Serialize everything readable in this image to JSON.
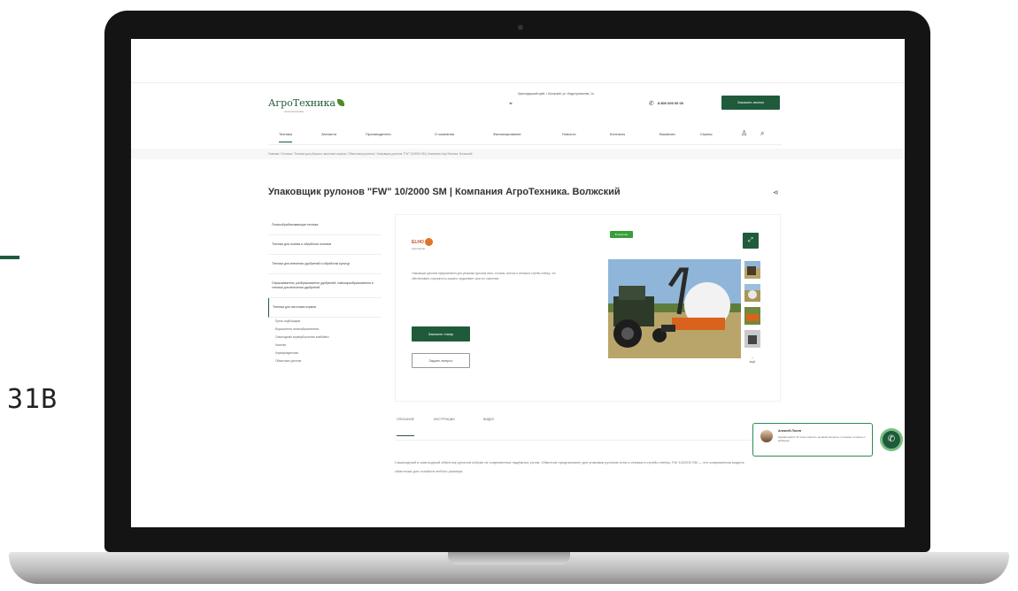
{
  "side_label": "31В",
  "header": {
    "logo_text": "АгроТехника",
    "logo_sub": "сельхозтехника",
    "address": "Краснодарский край, г. Волжский, ул. Индустриальная, 1а",
    "phone": "8 800 000 00 00",
    "callback_label": "Заказать звонок"
  },
  "nav": {
    "items": [
      "Техника",
      "Запчасти",
      "Производители",
      "О компании",
      "Финансирование",
      "Новости",
      "Контакты",
      "Вакансии",
      "Сервис"
    ],
    "active": "Техника"
  },
  "breadcrumb": "Главная  /  Техника  /  Техника для уборки и заготовки кормов  /  Обмотчики рулонов  /  Упаковщик рулонов \"FW\" 10/2000 SM | Компания АгроТехника. Волжский",
  "page_title": "Упаковщик рулонов \"FW\" 10/2000 SM | Компания АгроТехника. Волжский",
  "sidebar": {
    "items": [
      "Почвообрабатывающая техника",
      "Техника для посева и обработки посевов",
      "Техника для внесения удобрений и обработки культур",
      "Опрыскиватели, разбрасыватели удобрений, навозоразбрасыватели и техника для внесения удобрений",
      "Техника для заготовки кормов"
    ],
    "subitems": [
      "Пресс-подборщики",
      "Ворошители, валкообразователи",
      "Самоходные кормоуборочные комбайны",
      "Косилки",
      "Кормораздатчики",
      "Обмотчики рулонов"
    ]
  },
  "product": {
    "brand": "ELHO",
    "brand_sub": "Agricultural",
    "description": "Упаковщик рулонов предназначен для упаковки рулонов сена, соломы, силоса и сенажа в стрейч-плёнку, что обеспечивает сохранность корма и продлевает срок его хранения.",
    "badge": "В наличии",
    "order_label": "Заказать товар",
    "ask_label": "Задать вопрос",
    "more_label": "ещё"
  },
  "tabs": [
    "ОПИСАНИЕ",
    "ИНСТРУКЦИИ",
    "ВИДЕО"
  ],
  "description_text": "Самоходный и самоходный обмотчик рулонов собран из современных надёжных узлов. Обмотчик предназначен для упаковки рулонов сена и сенажа в стрейч-плёнку. FW 10/2000 SM — это современная модель обмотчика для хозяйств любого размера.",
  "chat": {
    "name": "Алексей Лосев",
    "message": "Здравствуйте! Я готов ответить на ваши вопросы о технике и помочь с выбором."
  },
  "colors": {
    "brand_green": "#1f5b3b",
    "badge_green": "#3b9e3a",
    "accent_orange": "#e0742a"
  }
}
